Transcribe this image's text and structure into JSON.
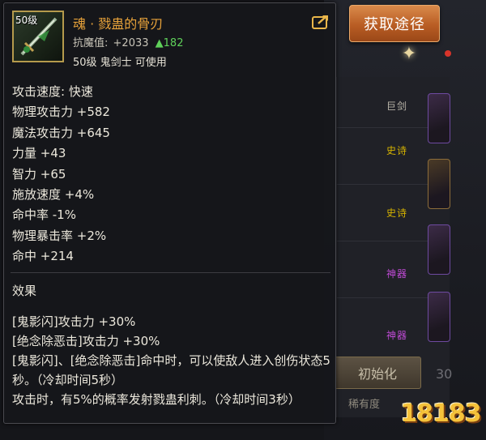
{
  "background": {
    "grades": [
      "巨剑",
      "史诗",
      "史诗",
      "神器",
      "神器"
    ],
    "source_button_label": "获取途径",
    "init_button_label": "初始化",
    "side_number": "30",
    "rarity_label": "稀有度"
  },
  "tooltip": {
    "icon": {
      "name": "sword-item-icon",
      "level_badge": "50级"
    },
    "item_name": "魂 · 戮蛊的骨刃",
    "resist_label": "抗魔值:",
    "resist_value": "+2033",
    "resist_bonus": "▲182",
    "requirement": "50级 鬼剑士 可使用",
    "share_icon": "share-icon",
    "stats": [
      "攻击速度:  快速",
      "物理攻击力 +582",
      "魔法攻击力 +645",
      "力量 +43",
      "智力 +65",
      "施放速度 +4%",
      "命中率 -1%",
      "物理暴击率 +2%",
      "命中 +214"
    ],
    "effects_title": "效果",
    "effects": [
      "[鬼影闪]攻击力 +30%",
      "[绝念除恶击]攻击力 +30%",
      "[鬼影闪]、[绝念除恶击]命中时，可以使敌人进入创伤状态5秒。（冷却时间5秒）",
      "攻击时，有5%的概率发射戮蛊利刺。（冷却时间3秒）"
    ]
  },
  "watermark": "18183",
  "colors": {
    "item_name": "#e9a33a",
    "bonus": "#5fd15a",
    "epic": "#d6b400",
    "artifact": "#c04bd6",
    "button": "#c56a2c"
  }
}
